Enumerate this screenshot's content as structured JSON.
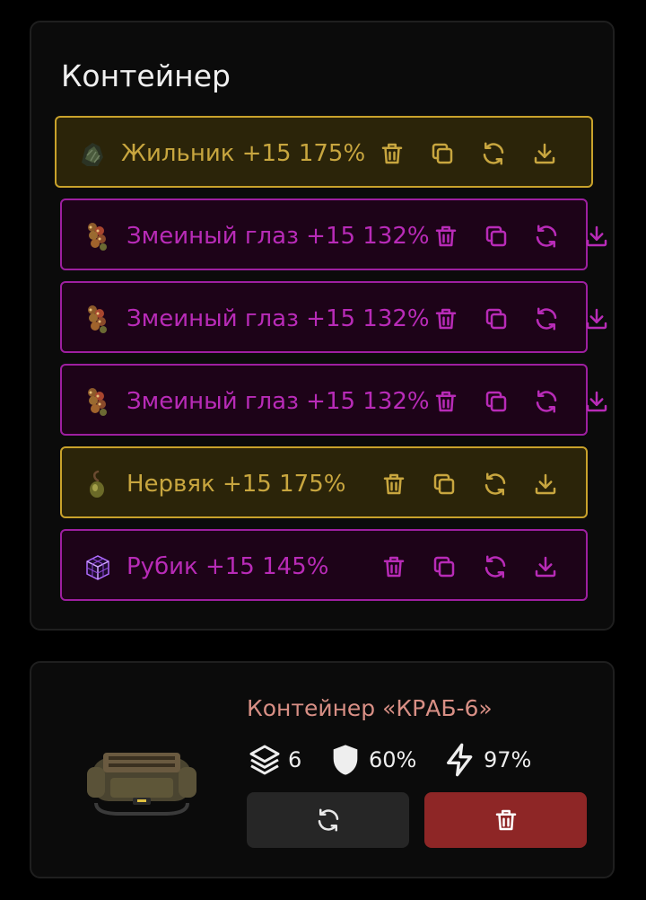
{
  "container_panel": {
    "title": "Контейнер"
  },
  "artifacts": [
    {
      "name": "Жильник +15 175%",
      "rarity": "gold",
      "icon": "zhilnik-artifact-icon"
    },
    {
      "name": "Змеиный глаз +15 132%",
      "rarity": "purple",
      "icon": "snake-eye-artifact-icon"
    },
    {
      "name": "Змеиный глаз +15 132%",
      "rarity": "purple",
      "icon": "snake-eye-artifact-icon"
    },
    {
      "name": "Змеиный глаз +15 132%",
      "rarity": "purple",
      "icon": "snake-eye-artifact-icon"
    },
    {
      "name": "Нервяк +15 175%",
      "rarity": "gold",
      "icon": "nervyak-artifact-icon"
    },
    {
      "name": "Рубик +15 145%",
      "rarity": "purple",
      "icon": "rubik-artifact-icon"
    }
  ],
  "row_actions": [
    "trash-icon",
    "copy-icon",
    "refresh-icon",
    "download-icon"
  ],
  "container_card": {
    "name": "Контейнер «КРАБ-6»",
    "stats": {
      "slots": "6",
      "protection": "60%",
      "efficiency": "97%"
    },
    "stat_icons": [
      "layers-icon",
      "shield-icon",
      "lightning-icon"
    ]
  },
  "colors": {
    "gold_border": "#c9a22b",
    "gold_text": "#c8a63f",
    "purple_border": "#9e1fa0",
    "purple_text": "#b82bb7",
    "container_name": "#d88f85",
    "delete_button": "#8e2626",
    "refresh_button": "#262626"
  }
}
